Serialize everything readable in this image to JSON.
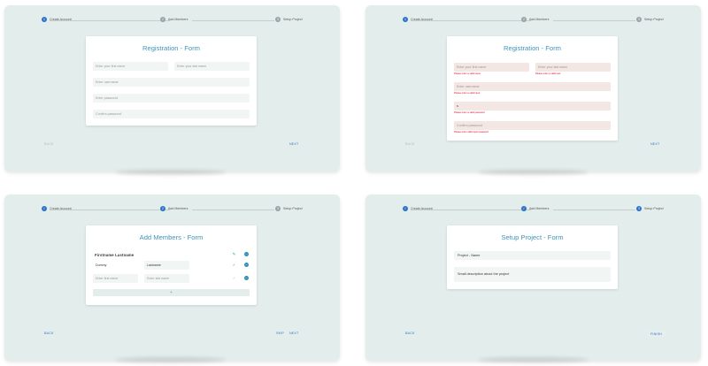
{
  "colors": {
    "accent": "#2e73c9",
    "title": "#3f93bd",
    "panel_bg": "#e3eeec",
    "error": "#d0021b",
    "field_bg": "#f1f6f5",
    "error_field_bg": "#f4e6e2",
    "success": "#2aa06e"
  },
  "icons": {
    "pencil": "pencil-icon",
    "check": "check-icon",
    "remove": "minus-circle-icon",
    "done_step": "check-icon"
  },
  "steps": [
    "Create Account",
    "Add Members",
    "Setup Project"
  ],
  "registration": {
    "title": "Registration - Form",
    "first_name_placeholder": "Enter your first name",
    "last_name_placeholder": "Enter your last name",
    "username_placeholder": "Enter username",
    "password_placeholder": "Enter password",
    "confirm_placeholder": "Confirm password"
  },
  "registration_errors": {
    "first_name": "Please enter a valid name",
    "last_name": "Please enter a valid user",
    "username": "Please enter a valid input",
    "password_value": "s",
    "password": "Please enter a valid password",
    "confirm": "Please enter valid input password"
  },
  "members": {
    "title": "Add Members - Form",
    "member_name": "Firstname Lastname",
    "row_first": "Dummy",
    "row_last": "Lastname",
    "first_placeholder": "Enter first name",
    "last_placeholder": "Enter last name",
    "add_label": "+"
  },
  "project": {
    "title": "Setup Project - Form",
    "name_value": "Project - Name",
    "description_value": "Small description about the project"
  },
  "nav": {
    "back": "BACK",
    "next": "NEXT",
    "skip": "SKIP",
    "finish": "FINISH"
  }
}
